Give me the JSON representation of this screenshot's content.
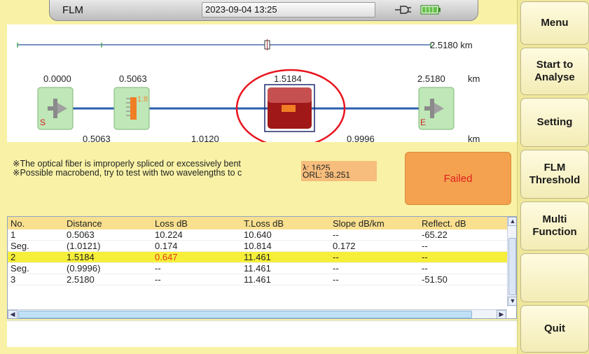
{
  "header": {
    "app_title": "FLM",
    "datetime": "2023-09-04 13:25",
    "icons": [
      "plug-icon",
      "battery-icon"
    ]
  },
  "menu": {
    "items": [
      {
        "label": "Menu"
      },
      {
        "label": "Start to\nAnalyse"
      },
      {
        "label": "Setting"
      },
      {
        "label": "FLM\nThreshold"
      },
      {
        "label": "Multi\nFunction"
      },
      {
        "label": ""
      },
      {
        "label": "Quit"
      }
    ]
  },
  "map": {
    "total_length": "2.5180 km",
    "unit": "km",
    "positions": [
      "0.0000",
      "0.5063",
      "1.5184",
      "2.5180"
    ],
    "segments": [
      "0.5063",
      "1.0120",
      "0.9996"
    ],
    "splitter_label": "1:8",
    "start_marker": "S",
    "end_marker": "E",
    "icons": [
      "start-event-icon",
      "splitter-icon",
      "fault-event-icon",
      "end-event-icon"
    ]
  },
  "message": {
    "lines": [
      "※The optical fiber is improperly spliced or excessively bent",
      "※Possible macrobend, try to test with two wavelengths to c"
    ],
    "lambda": "λ: 1625",
    "orl": "ORL: 38.251",
    "status": "Failed"
  },
  "table": {
    "headers": [
      "No.",
      "Distance",
      "Loss dB",
      "T.Loss dB",
      "Slope dB/km",
      "Reflect. dB"
    ],
    "rows": [
      [
        "1",
        "0.5063",
        "10.224",
        "10.640",
        "--",
        "-65.22"
      ],
      [
        "Seg.",
        "(1.0121)",
        "0.174",
        "10.814",
        "0.172",
        "--"
      ],
      [
        "2",
        "1.5184",
        "0.647",
        "11.461",
        "--",
        "--"
      ],
      [
        "Seg.",
        "(0.9996)",
        "--",
        "11.461",
        "--",
        "--"
      ],
      [
        "3",
        "2.5180",
        "--",
        "11.461",
        "--",
        "-51.50"
      ]
    ],
    "highlighted_row": 2
  },
  "colors": {
    "background": "#f9f2a6",
    "fiber_line": "#2b5fb0",
    "fault_event": "#a01818",
    "highlight_row": "#f6ef3a",
    "failed_box": "#f4a24f",
    "failed_text": "#e02020"
  }
}
